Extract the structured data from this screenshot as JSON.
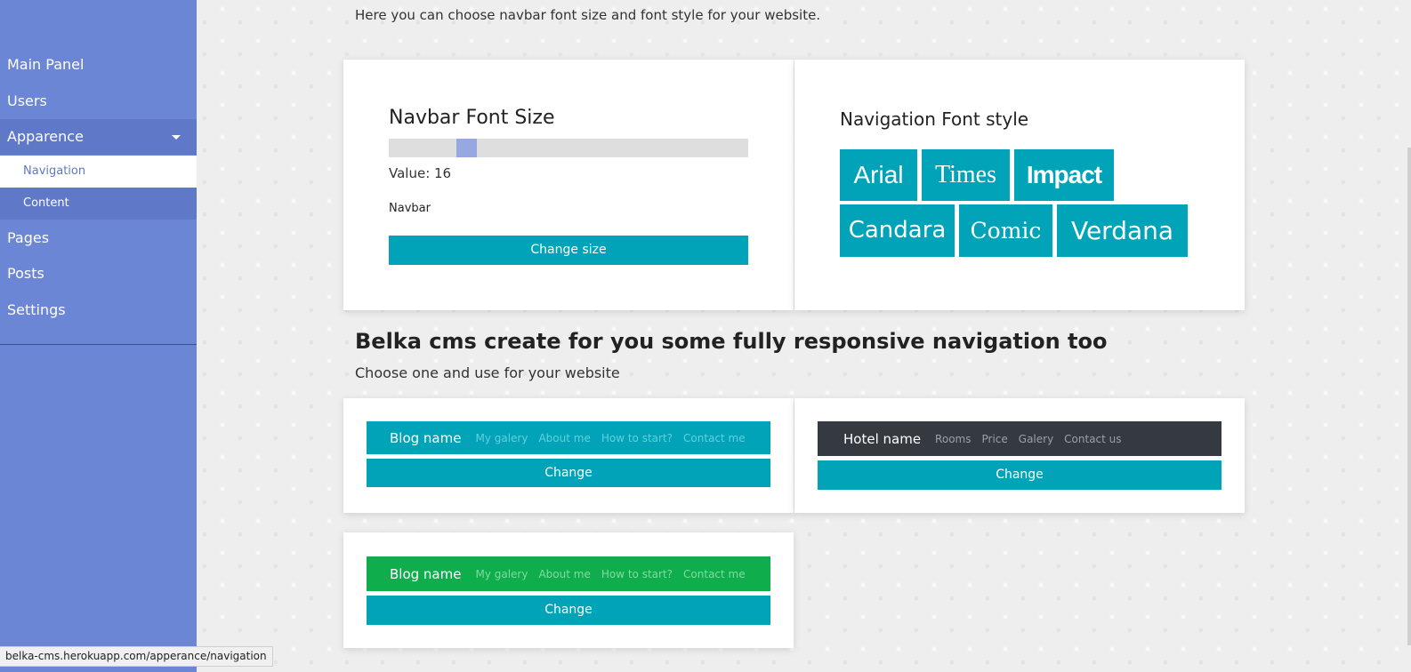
{
  "sidebar": {
    "items": [
      {
        "label": "Main Panel"
      },
      {
        "label": "Users"
      },
      {
        "label": "Apparence"
      },
      {
        "label": "Navigation"
      },
      {
        "label": "Content"
      },
      {
        "label": "Pages"
      },
      {
        "label": "Posts"
      },
      {
        "label": "Settings"
      }
    ]
  },
  "main": {
    "intro": "Here you can choose navbar font size and font style for your website.",
    "font_size_card": {
      "title": "Navbar Font Size",
      "value_label": "Value: 16",
      "slider_value": 16,
      "sample_text": "Navbar",
      "button": "Change size"
    },
    "font_style_card": {
      "title": "Navigation Font style",
      "fonts": [
        "Arial",
        "Times",
        "Impact",
        "Candara",
        "Comic",
        "Verdana"
      ]
    },
    "section_title": "Belka cms create for you some fully responsive navigation too",
    "section_sub": "Choose one and use for your website",
    "nav_templates": [
      {
        "brand": "Blog name",
        "links": [
          "My galery",
          "About me",
          "How to start?",
          "Contact me"
        ],
        "button": "Change",
        "bg": "#00a3b8",
        "link_color": "#63cfdc"
      },
      {
        "brand": "Hotel name",
        "links": [
          "Rooms",
          "Price",
          "Galery",
          "Contact us"
        ],
        "button": "Change",
        "bg": "#343a40",
        "link_color": "#9aa0a6"
      },
      {
        "brand": "Blog name",
        "links": [
          "My galery",
          "About me",
          "How to start?",
          "Contact me"
        ],
        "button": "Change",
        "bg": "#0fad4b",
        "link_color": "#7fdba0"
      }
    ]
  },
  "statusbar": {
    "url": "belka-cms.herokuapp.com/apperance/navigation"
  },
  "colors": {
    "sidebar": "#6c86d6",
    "accent": "#00a3b8",
    "selected_text": "#5f78c8"
  }
}
